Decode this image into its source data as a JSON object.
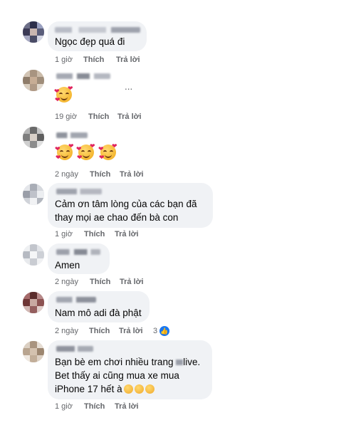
{
  "labels": {
    "like": "Thích",
    "reply": "Trả lời"
  },
  "comments": [
    {
      "text": "Ngọc đẹp quá đi",
      "time": "1 giờ"
    },
    {
      "text": "",
      "time": "19 giờ",
      "extra": "..."
    },
    {
      "text": "",
      "time": "2 ngày"
    },
    {
      "text": "Cảm ơn tâm lòng của các bạn đã",
      "text2": "thay mọi ae chao đến bà con",
      "time": "1 giờ"
    },
    {
      "text": "Amen",
      "time": "2 ngày"
    },
    {
      "text": "Nam mô adi đà phật",
      "time": "2 ngày",
      "reaction_count": "3"
    },
    {
      "text": "Bạn bè em chơi nhiều trang",
      "text_tail": "live.",
      "text2": "Bet thấy ai cũng mua xe mua",
      "text3": "iPhone 17 hết à",
      "time": "1 giờ"
    }
  ],
  "colors": {
    "bubble": "#f0f2f5",
    "meta": "#65676b",
    "text": "#050505",
    "like_blue": "#1877f2"
  }
}
